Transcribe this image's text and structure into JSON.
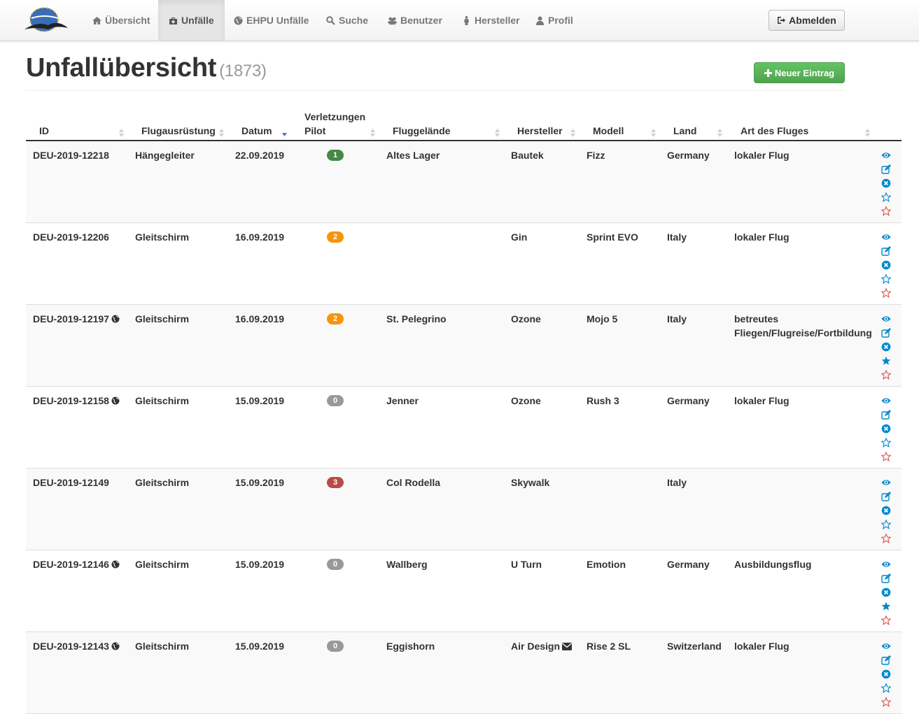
{
  "nav": {
    "items": [
      {
        "label": "Übersicht",
        "icon": "home-icon",
        "active": false
      },
      {
        "label": "Unfälle",
        "icon": "medkit-icon",
        "active": true
      },
      {
        "label": "EHPU Unfälle",
        "icon": "globe-icon",
        "active": false
      },
      {
        "label": "Suche",
        "icon": "search-icon",
        "active": false
      },
      {
        "label": "Benutzer",
        "icon": "users-icon",
        "active": false
      },
      {
        "label": "Hersteller",
        "icon": "male-icon",
        "active": false
      },
      {
        "label": "Profil",
        "icon": "user-icon",
        "active": false
      }
    ],
    "logout_label": "Abmelden"
  },
  "header": {
    "title": "Unfallübersicht",
    "count": "(1873)",
    "new_button": "Neuer Eintrag"
  },
  "colors": {
    "accent_green": "#51a351",
    "badge_green": "#468847",
    "badge_orange": "#f89406",
    "badge_grey": "#999999",
    "badge_red": "#b94a48",
    "icon_blue": "#0088cc",
    "star_red": "#d9534f"
  },
  "table": {
    "columns": [
      {
        "key": "id",
        "label": "ID"
      },
      {
        "key": "equipment",
        "label": "Flugausrüstung"
      },
      {
        "key": "date",
        "label": "Datum"
      },
      {
        "key": "injury",
        "label_line1": "Verletzungen",
        "label_line2": "Pilot"
      },
      {
        "key": "site",
        "label": "Fluggelände"
      },
      {
        "key": "manufacturer",
        "label": "Hersteller"
      },
      {
        "key": "model",
        "label": "Modell"
      },
      {
        "key": "country",
        "label": "Land"
      },
      {
        "key": "flight_type",
        "label": "Art des Fluges"
      }
    ],
    "sorted_by": "date",
    "rows": [
      {
        "id": "DEU-2019-12218",
        "globe": false,
        "equipment": "Hängegleiter",
        "date": "22.09.2019",
        "injury": "1",
        "injury_color": "#468847",
        "site": "Altes Lager",
        "manufacturer": "Bautek",
        "mail": false,
        "model": "Fizz",
        "country": "Germany",
        "flight_type": "lokaler Flug",
        "starred": false
      },
      {
        "id": "DEU-2019-12206",
        "globe": false,
        "equipment": "Gleitschirm",
        "date": "16.09.2019",
        "injury": "2",
        "injury_color": "#f89406",
        "site": "",
        "manufacturer": "Gin",
        "mail": false,
        "model": "Sprint EVO",
        "country": "Italy",
        "flight_type": "lokaler Flug",
        "starred": false
      },
      {
        "id": "DEU-2019-12197",
        "globe": true,
        "equipment": "Gleitschirm",
        "date": "16.09.2019",
        "injury": "2",
        "injury_color": "#f89406",
        "site": "St. Pelegrino",
        "manufacturer": "Ozone",
        "mail": false,
        "model": "Mojo 5",
        "country": "Italy",
        "flight_type": "betreutes Fliegen/Flugreise/Fortbildung",
        "starred": true
      },
      {
        "id": "DEU-2019-12158",
        "globe": true,
        "equipment": "Gleitschirm",
        "date": "15.09.2019",
        "injury": "0",
        "injury_color": "#999999",
        "site": "Jenner",
        "manufacturer": "Ozone",
        "mail": false,
        "model": "Rush 3",
        "country": "Germany",
        "flight_type": "lokaler Flug",
        "starred": false
      },
      {
        "id": "DEU-2019-12149",
        "globe": false,
        "equipment": "Gleitschirm",
        "date": "15.09.2019",
        "injury": "3",
        "injury_color": "#b94a48",
        "site": "Col Rodella",
        "manufacturer": "Skywalk",
        "mail": false,
        "model": "",
        "country": "Italy",
        "flight_type": "",
        "starred": false
      },
      {
        "id": "DEU-2019-12146",
        "globe": true,
        "equipment": "Gleitschirm",
        "date": "15.09.2019",
        "injury": "0",
        "injury_color": "#999999",
        "site": "Wallberg",
        "manufacturer": "U Turn",
        "mail": false,
        "model": "Emotion",
        "country": "Germany",
        "flight_type": "Ausbildungsflug",
        "starred": true
      },
      {
        "id": "DEU-2019-12143",
        "globe": true,
        "equipment": "Gleitschirm",
        "date": "15.09.2019",
        "injury": "0",
        "injury_color": "#999999",
        "site": "Eggishorn",
        "manufacturer": "Air Design",
        "mail": true,
        "model": "Rise 2 SL",
        "country": "Switzerland",
        "flight_type": "lokaler Flug",
        "starred": false
      }
    ]
  }
}
